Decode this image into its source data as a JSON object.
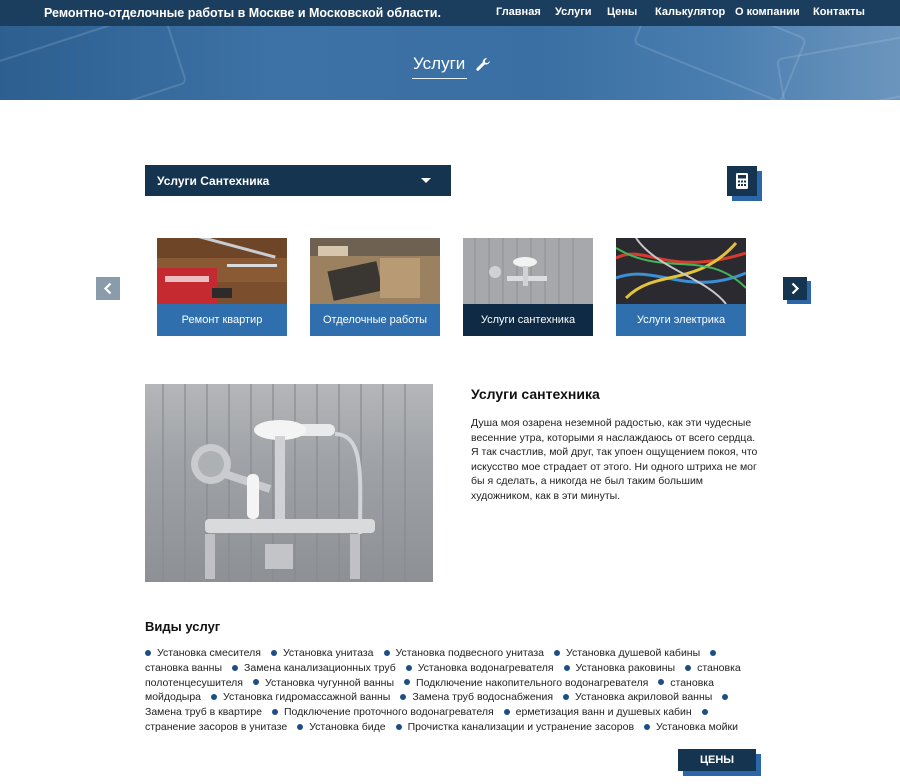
{
  "header": {
    "site_title": "Ремонтно-отделочные работы в Москве и Московской области.",
    "nav": [
      "Главная",
      "Услуги",
      "Цены",
      "Калькулятор",
      "О компании",
      "Контакты"
    ]
  },
  "banner": {
    "title": "Услуги",
    "icon": "wrench-icon"
  },
  "dropdown": {
    "selected": "Услуги Сантехника"
  },
  "calculator_button": {
    "icon": "calculator-icon"
  },
  "carousel": {
    "items": [
      {
        "label": "Ремонт квартир"
      },
      {
        "label": "Отделочные работы"
      },
      {
        "label": "Услуги сантехника"
      },
      {
        "label": "Услуги электрика"
      }
    ],
    "active_index": 2
  },
  "content": {
    "title": "Услуги сантехника",
    "text": "Душа моя озарена неземной радостью, как эти чудесные весенние утра, которыми я наслаждаюсь от всего сердца. Я так счастлив, мой друг, так упоен ощущением покоя, что искусство мое страдает от этого. Ни одного штриха не мог бы я сделать, а никогда не был таким большим художником, как в эти минуты."
  },
  "service_types": {
    "title": "Виды услуг",
    "items": [
      "Установка смесителя",
      "Установка унитаза",
      "Установка подвесного унитаза",
      "Установка душевой кабины",
      "становка ванны",
      "Замена канализационных труб",
      "Установка водонагревателя",
      "Установка раковины",
      "становка полотенцесушителя",
      "Установка чугунной ванны",
      "Подключение накопительного водонагревателя",
      "становка мойдодыра",
      "Установка гидромассажной ванны",
      "Замена труб водоснабжения",
      "Установка акриловой ванны",
      "Замена труб в квартире",
      "Подключение проточного водонагревателя",
      "ерметизация ванн и душевых кабин",
      "странение засоров в унитазе",
      "Установка биде",
      "Прочистка канализации и устранение засоров",
      "Установка мойки"
    ]
  },
  "prices_button": {
    "label": "ЦЕНЫ"
  },
  "colors": {
    "topbar": "#1c3e5e",
    "navy": "#143450",
    "accent": "#2f6fae",
    "bullet": "#1d4f86"
  }
}
